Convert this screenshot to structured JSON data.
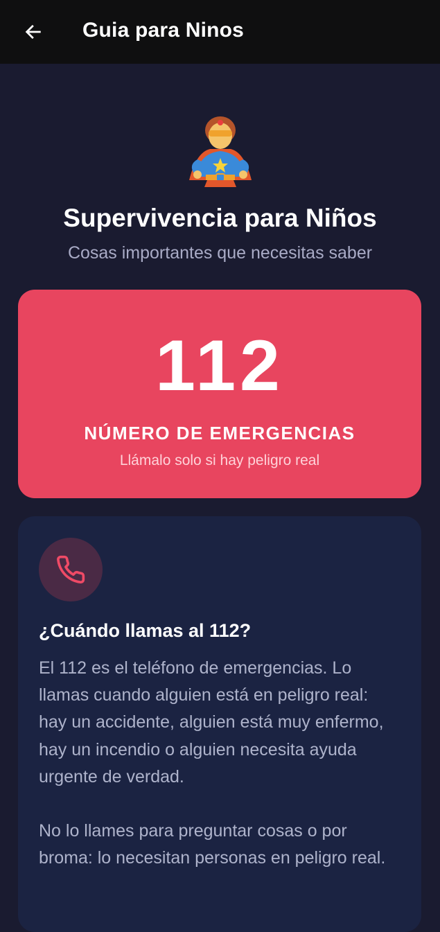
{
  "appbar": {
    "title": "Guia para Ninos",
    "back_icon": "arrow-left-icon"
  },
  "hero": {
    "icon": "superhero-emoji-icon",
    "title": "Supervivencia para Niños",
    "subtitle": "Cosas importantes que necesitas saber"
  },
  "emergency": {
    "number": "112",
    "label": "NÚMERO DE EMERGENCIAS",
    "note": "Llámalo solo si hay peligro real",
    "color": "#e8455f"
  },
  "info_card": {
    "icon": "phone-icon",
    "title": "¿Cuándo llamas al 112?",
    "paragraphs": [
      "El 112 es el teléfono de emergencias. Lo llamas cuando alguien está en peligro real: hay un accidente, alguien está muy enfermo, hay un incendio o alguien necesita ayuda urgente de verdad.",
      "No lo llames para preguntar cosas o por broma: lo necesitan personas en peligro real."
    ]
  }
}
